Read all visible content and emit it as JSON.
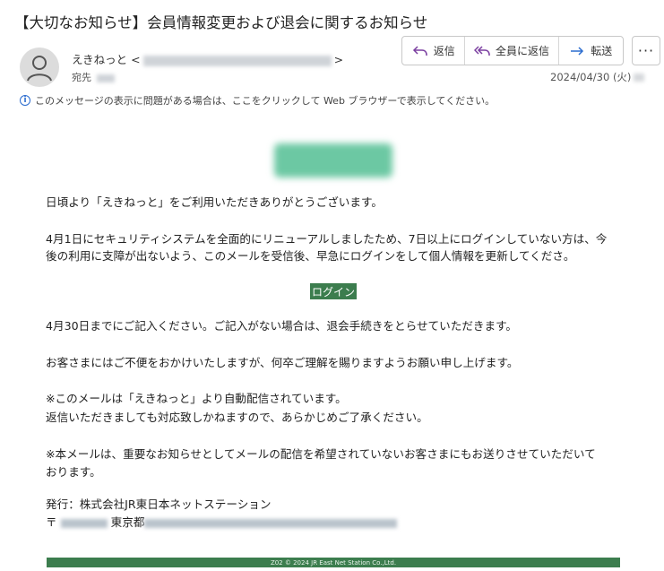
{
  "email": {
    "subject": "【大切なお知らせ】会員情報変更および退会に関するお知らせ",
    "sender_name": "えきねっと",
    "sender_email_open": "<",
    "sender_email_close": ">",
    "to_label": "宛先",
    "date": "2024/04/30 (火)",
    "info_text": "このメッセージの表示に問題がある場合は、ここをクリックして Web ブラウザーで表示してください。"
  },
  "toolbar": {
    "reply_label": "返信",
    "reply_all_label": "全員に返信",
    "forward_label": "転送",
    "more_label": "···"
  },
  "colors": {
    "accent_green": "#3c7d4e",
    "info_blue": "#2b6ccf"
  },
  "body": {
    "greeting": "日頃より「えきねっと」をご利用いただきありがとうございます。",
    "para1_line1": "4月1日にセキュリティシステムを全面的にリニューアルしましたため、7日以上にログインしていない方は、今",
    "para1_line2": "後の利用に支障が出ないよう、このメールを受信後、早急にログインをして個人情報を更新してくださ。",
    "login_button": "ログイン",
    "para2": "4月30日までにご記入ください。ご記入がない場合は、退会手続きをとらせていただきます。",
    "para3": "お客さまにはご不便をおかけいたしますが、何卒ご理解を賜りますようお願い申し上げます。",
    "notice1_line1": "※このメールは「えきねっと」より自動配信されています。",
    "notice1_line2": "返信いただきましても対応致しかねますので、あらかじめご了承ください。",
    "notice2_line1": "※本メールは、重要なお知らせとしてメールの配信を希望されていないお客さまにもお送りさせていただいて",
    "notice2_line2": "おります。",
    "publisher": "発行：株式会社JR東日本ネットステーション",
    "address_prefix": "〒",
    "address_city": "東京都",
    "footer": "Z02 © 2024 JR East Net Station Co.,Ltd."
  }
}
